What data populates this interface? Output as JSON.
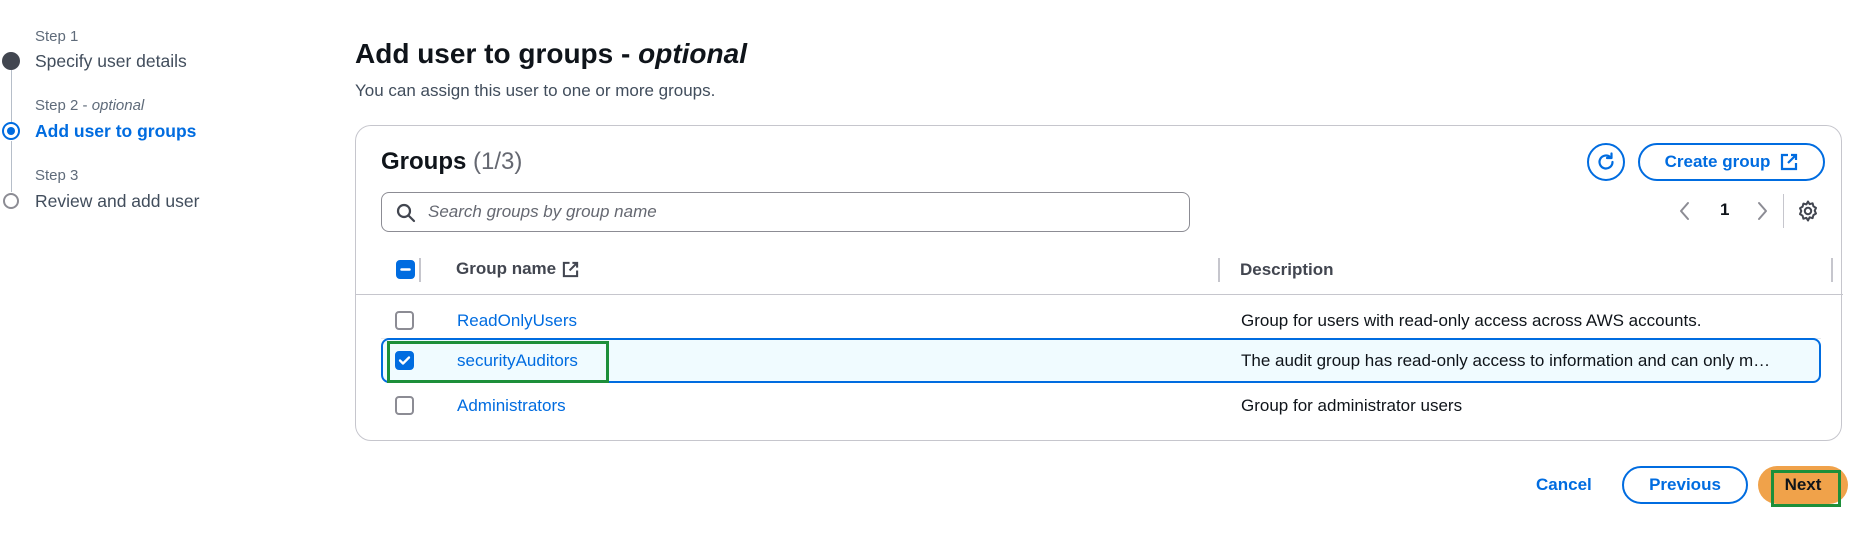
{
  "stepper": {
    "steps": [
      {
        "number": "Step 1",
        "optional": "",
        "name": "Specify user details",
        "state": "done"
      },
      {
        "number": "Step 2",
        "optional": "optional",
        "name": "Add user to groups",
        "state": "active"
      },
      {
        "number": "Step 3",
        "optional": "",
        "name": "Review and add user",
        "state": "todo"
      }
    ],
    "separator": " - "
  },
  "header": {
    "title": "Add user to groups - ",
    "title_optional": "optional",
    "description": "You can assign this user to one or more groups."
  },
  "groups": {
    "title": "Groups",
    "count": "(1/3)",
    "create_label": "Create group",
    "search_placeholder": "Search groups by group name",
    "search_value": "",
    "page": "1",
    "columns": {
      "name": "Group name",
      "description": "Description"
    },
    "rows": [
      {
        "name": "ReadOnlyUsers",
        "description": "Group for users with read-only access across AWS accounts.",
        "selected": false
      },
      {
        "name": "securityAuditors",
        "description": "The audit group has read-only access to information and can only m…",
        "selected": true
      },
      {
        "name": "Administrators",
        "description": "Group for administrator users",
        "selected": false
      }
    ]
  },
  "footer": {
    "cancel_label": "Cancel",
    "previous_label": "Previous",
    "next_label": "Next"
  },
  "colors": {
    "accent": "#006ce0",
    "primary_button": "#f0a24a",
    "highlight": "#1d8f3a"
  }
}
